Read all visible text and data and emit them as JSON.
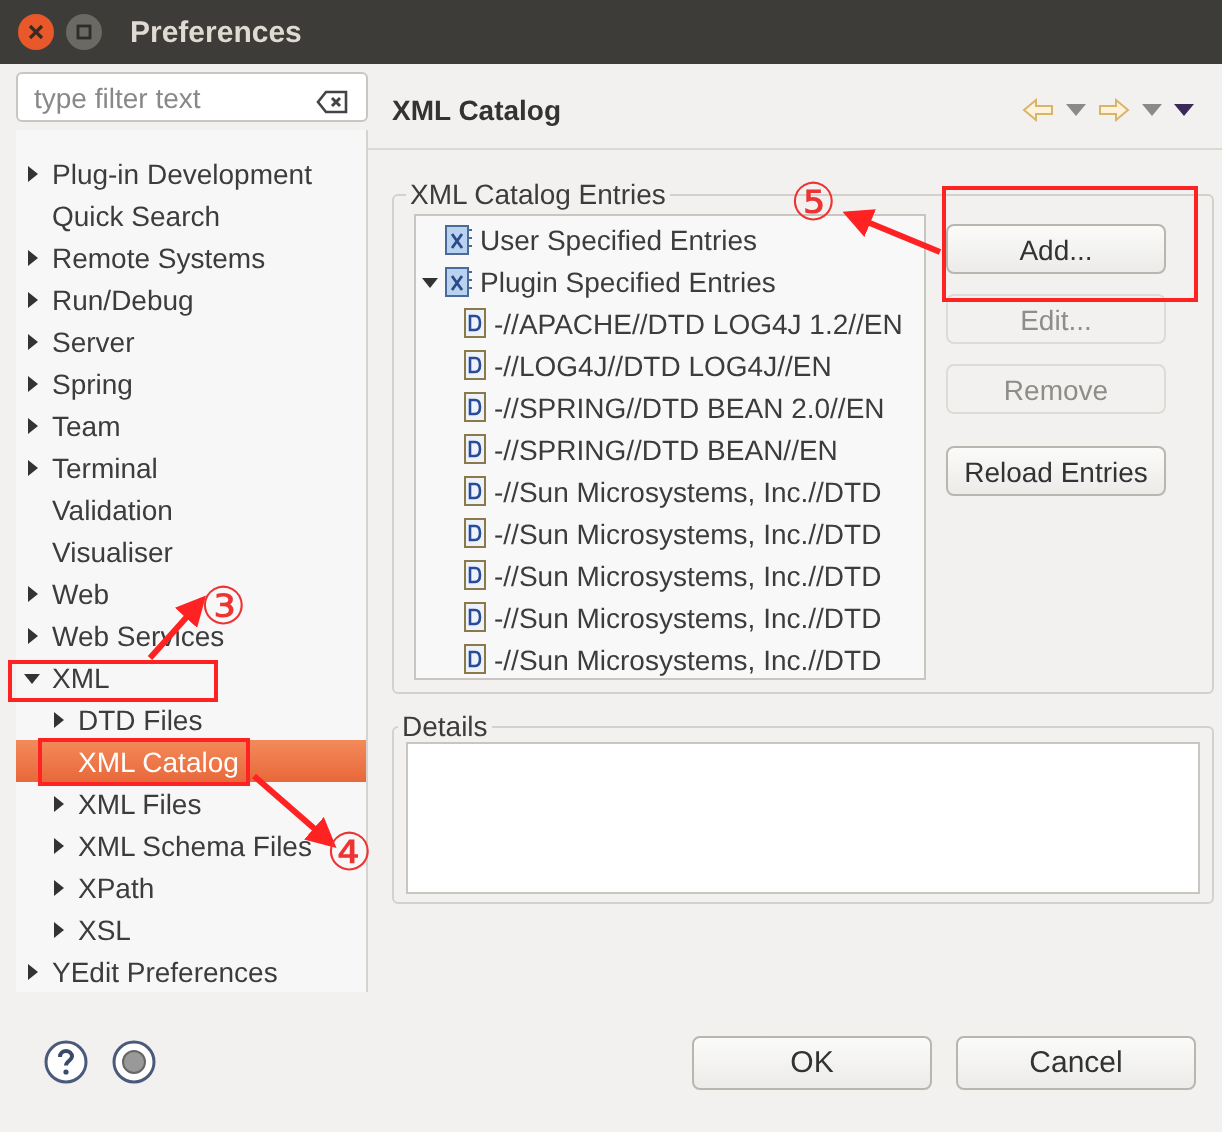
{
  "window": {
    "title": "Preferences"
  },
  "filter": {
    "placeholder": "type filter text"
  },
  "sidebar": {
    "items": [
      {
        "label": "Plug-in Development",
        "expanded": false,
        "selected": false
      },
      {
        "label": "Quick Search",
        "selected": false
      },
      {
        "label": "Remote Systems",
        "expanded": false,
        "selected": false
      },
      {
        "label": "Run/Debug",
        "expanded": false,
        "selected": false
      },
      {
        "label": "Server",
        "expanded": false,
        "selected": false
      },
      {
        "label": "Spring",
        "expanded": false,
        "selected": false
      },
      {
        "label": "Team",
        "expanded": false,
        "selected": false
      },
      {
        "label": "Terminal",
        "expanded": false,
        "selected": false
      },
      {
        "label": "Validation",
        "selected": false
      },
      {
        "label": "Visualiser",
        "selected": false
      },
      {
        "label": "Web",
        "expanded": false,
        "selected": false
      },
      {
        "label": "Web Services",
        "expanded": false,
        "selected": false
      },
      {
        "label": "XML",
        "expanded": true,
        "selected": false,
        "children": [
          {
            "label": "DTD Files",
            "expanded": false,
            "selected": false
          },
          {
            "label": "XML Catalog",
            "selected": true
          },
          {
            "label": "XML Files",
            "expanded": false,
            "selected": false
          },
          {
            "label": "XML Schema Files",
            "expanded": false,
            "selected": false
          },
          {
            "label": "XPath",
            "expanded": false,
            "selected": false
          },
          {
            "label": "XSL",
            "expanded": false,
            "selected": false
          }
        ]
      },
      {
        "label": "YEdit Preferences",
        "expanded": false,
        "selected": false
      }
    ]
  },
  "page": {
    "title": "XML Catalog",
    "entries": {
      "legend": "XML Catalog Entries",
      "items": [
        {
          "label": "User Specified Entries",
          "kind": "catalog"
        },
        {
          "label": "Plugin Specified Entries",
          "kind": "catalog",
          "expanded": true,
          "children": [
            {
              "label": "-//APACHE//DTD LOG4J 1.2//EN",
              "kind": "dtd"
            },
            {
              "label": "-//LOG4J//DTD LOG4J//EN",
              "kind": "dtd"
            },
            {
              "label": "-//SPRING//DTD BEAN 2.0//EN",
              "kind": "dtd"
            },
            {
              "label": "-//SPRING//DTD BEAN//EN",
              "kind": "dtd"
            },
            {
              "label": "-//Sun Microsystems, Inc.//DTD",
              "kind": "dtd"
            },
            {
              "label": "-//Sun Microsystems, Inc.//DTD",
              "kind": "dtd"
            },
            {
              "label": "-//Sun Microsystems, Inc.//DTD",
              "kind": "dtd"
            },
            {
              "label": "-//Sun Microsystems, Inc.//DTD",
              "kind": "dtd"
            },
            {
              "label": "-//Sun Microsystems, Inc.//DTD",
              "kind": "dtd"
            }
          ]
        }
      ],
      "buttons": [
        {
          "label": "Add...",
          "disabled": false
        },
        {
          "label": "Edit...",
          "disabled": true
        },
        {
          "label": "Remove",
          "disabled": true
        },
        {
          "label": "Reload Entries",
          "disabled": false
        }
      ]
    },
    "details": {
      "legend": "Details"
    }
  },
  "buttons": [
    {
      "label": "OK"
    },
    {
      "label": "Cancel"
    }
  ],
  "annotations": [
    {
      "label": "③"
    },
    {
      "label": "④"
    },
    {
      "label": "⑤"
    }
  ]
}
